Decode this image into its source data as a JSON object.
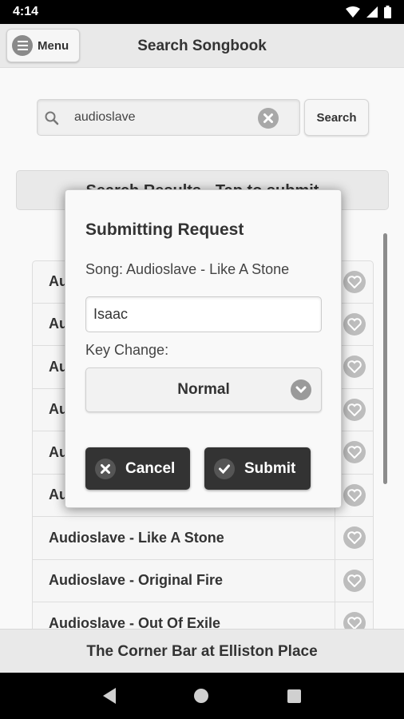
{
  "status_bar": {
    "time": "4:14"
  },
  "header": {
    "menu_label": "Menu",
    "title": "Search Songbook"
  },
  "search": {
    "value": "audioslave",
    "button_label": "Search"
  },
  "results": {
    "header": "Search Results - Tap to submit",
    "items": [
      {
        "title": "Audioslave - Be Yourself"
      },
      {
        "title": "Audioslave - Cochise"
      },
      {
        "title": "Audioslave - Doesn't Remind Me"
      },
      {
        "title": "Audioslave - Gasoline"
      },
      {
        "title": "Audioslave - I Am The Highway"
      },
      {
        "title": "Audioslave - Like A Stone"
      },
      {
        "title": "Audioslave - Like A Stone"
      },
      {
        "title": "Audioslave - Original Fire"
      },
      {
        "title": "Audioslave - Out Of Exile"
      }
    ]
  },
  "footer": {
    "venue": "The Corner Bar at Elliston Place"
  },
  "dialog": {
    "title": "Submitting Request",
    "song": "Song: Audioslave - Like A Stone",
    "name_value": "Isaac",
    "key_label": "Key Change:",
    "key_value": "Normal",
    "cancel_label": "Cancel",
    "submit_label": "Submit"
  },
  "colors": {
    "button_dark": "#333333",
    "icon_gray": "#bdbdbd",
    "header_bg": "#e9e9e9"
  }
}
